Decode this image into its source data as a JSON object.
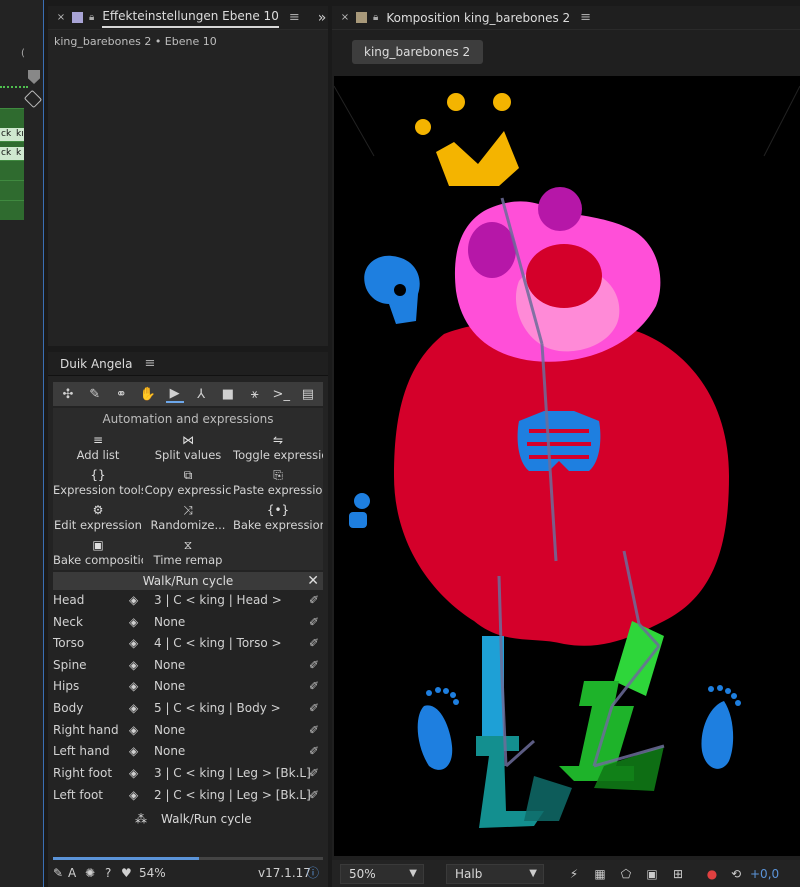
{
  "left_strip": {
    "header_char": "(",
    "key_labels": [
      "ck",
      "kı",
      "ck",
      "k"
    ]
  },
  "effects_panel": {
    "close": "×",
    "title": "Effekteinstellungen Ebene 10",
    "subtitle": "king_barebones 2 • Ebene 10",
    "expand": "»",
    "swatch_color": "#a9a4d6"
  },
  "composition_panel": {
    "close": "×",
    "title": "Komposition king_barebones 2",
    "subtab": "king_barebones 2",
    "swatch_color": "#a8997a",
    "footer": {
      "zoom": "50%",
      "resolution": "Halb",
      "exposure": "+0,0"
    }
  },
  "duik": {
    "title": "Duik Angela",
    "toolbar": [
      "links-icon",
      "brush-icon",
      "link-icon",
      "hand-icon",
      "play-icon",
      "bone-icon",
      "camera-icon",
      "rig-icon",
      "terminal-icon",
      "document-icon"
    ],
    "section_title": "Automation and expressions",
    "tools": [
      {
        "icon": "≡",
        "label": "Add list"
      },
      {
        "icon": "⋈",
        "label": "Split values"
      },
      {
        "icon": "⇋",
        "label": "Toggle expressior"
      },
      {
        "icon": "{}",
        "label": "Expression tools"
      },
      {
        "icon": "⧉",
        "label": "Copy expressic"
      },
      {
        "icon": "⎘",
        "label": "Paste expression"
      },
      {
        "icon": "⚙",
        "label": "Edit expression"
      },
      {
        "icon": "⤨",
        "label": "Randomize..."
      },
      {
        "icon": "{•}",
        "label": "Bake expressions"
      },
      {
        "icon": "▣",
        "label": "Bake compositio"
      },
      {
        "icon": "⧖",
        "label": "Time remap"
      }
    ],
    "walk_title": "Walk/Run cycle",
    "walk_close": "✕",
    "rows": [
      {
        "label": "Head",
        "value": "3 | C < king | Head >"
      },
      {
        "label": "Neck",
        "value": "None"
      },
      {
        "label": "Torso",
        "value": "4 | C < king | Torso >"
      },
      {
        "label": "Spine",
        "value": "None"
      },
      {
        "label": "Hips",
        "value": "None"
      },
      {
        "label": "Body",
        "value": "5 | C < king | Body >"
      },
      {
        "label": "Right hand",
        "value": "None"
      },
      {
        "label": "Left hand",
        "value": "None"
      },
      {
        "label": "Right foot",
        "value": "3 | C < king | Leg > [Bk.L]"
      },
      {
        "label": "Left foot",
        "value": "2 | C < king | Leg > [Bk.L]"
      }
    ],
    "walk_button": "Walk/Run cycle",
    "progress": 0.54,
    "footer": {
      "memory": "54%",
      "version": "v17.1.17"
    }
  }
}
